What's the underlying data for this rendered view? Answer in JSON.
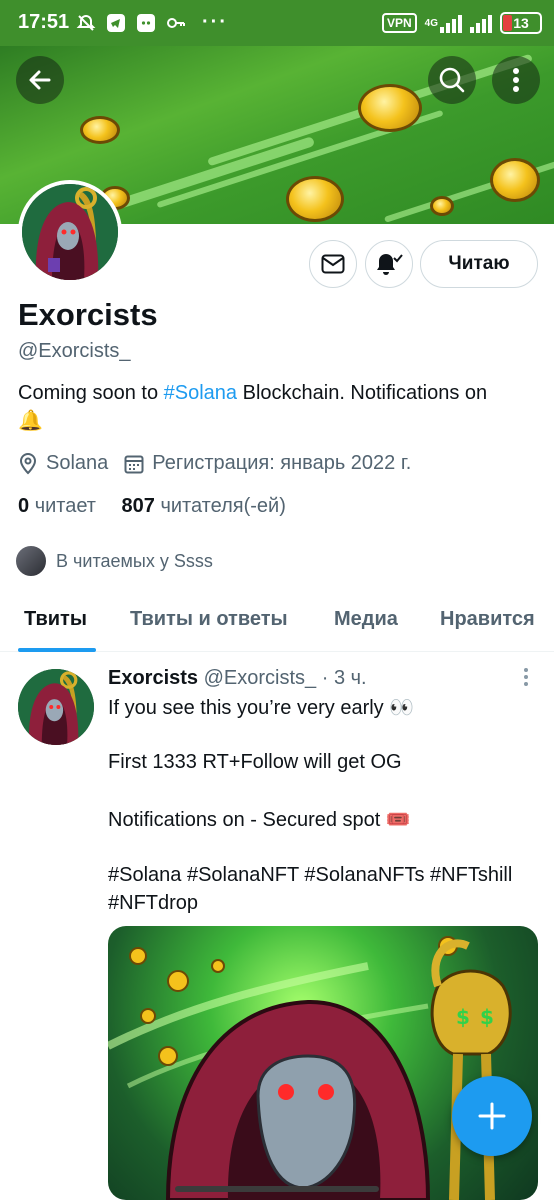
{
  "status_bar": {
    "time": "17:51",
    "vpn": "VPN",
    "network": "4G",
    "battery": "13"
  },
  "header": {
    "back_icon": "arrow-left-icon",
    "search_icon": "search-icon",
    "more_icon": "more-vertical-icon"
  },
  "profile": {
    "name": "Exorcists",
    "handle": "@Exorcists_",
    "follow_button": "Читаю",
    "bio_prefix": "Coming soon to ",
    "bio_hashtag": "#Solana",
    "bio_suffix": " Blockchain. Notifications on",
    "bio_emoji": "🔔",
    "location": "Solana",
    "joined": "Регистрация: январь 2022 г.",
    "following_count": "0",
    "following_label": "читает",
    "followers_count": "807",
    "followers_label": "читателя(-ей)",
    "followed_by": "В читаемых у Ssss"
  },
  "tabs": [
    {
      "label": "Твиты",
      "active": true
    },
    {
      "label": "Твиты и ответы",
      "active": false
    },
    {
      "label": "Медиа",
      "active": false
    },
    {
      "label": "Нравится",
      "active": false
    }
  ],
  "tweet": {
    "author": "Exorcists",
    "handle": "@Exorcists_",
    "time": " · 3 ч.",
    "line1": "If you see this you’re very early 👀",
    "line2": "First 1333 RT+Follow will get OG",
    "line3": "Notifications on - Secured spot 🎟️",
    "hashtags1": "#Solana #SolanaNFT #SolanaNFTs #NFTshill",
    "hashtags2": "#NFTdrop"
  },
  "colors": {
    "accent": "#1d9bf0",
    "status_bar": "#3f8f2c",
    "text": "#0f1419",
    "muted": "#536471"
  }
}
